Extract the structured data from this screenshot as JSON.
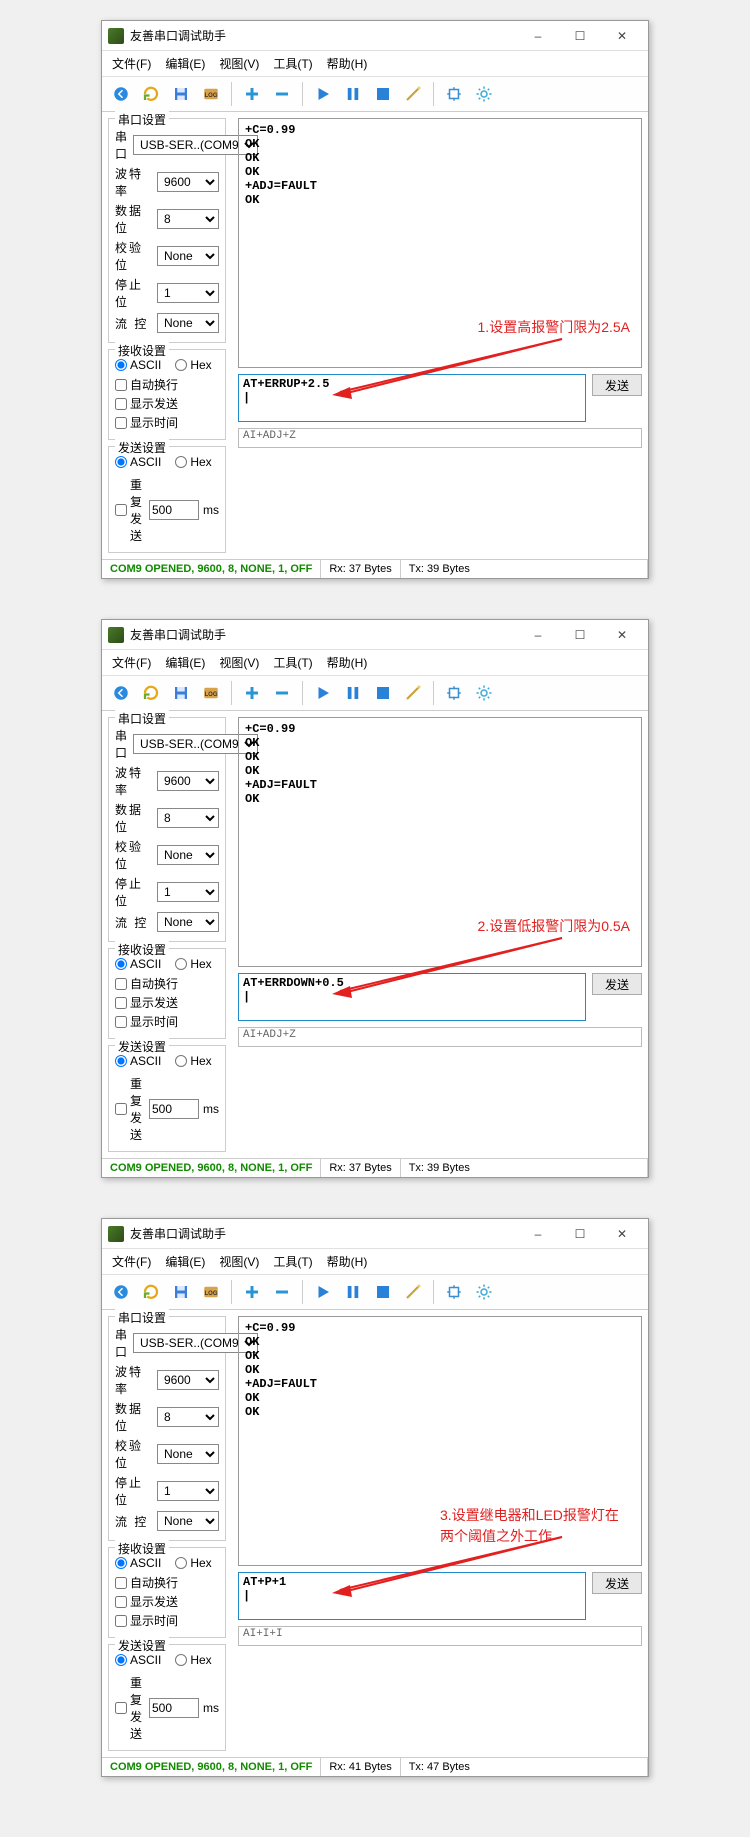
{
  "common": {
    "title": "友善串口调试助手",
    "menus": {
      "file": "文件(F)",
      "edit": "编辑(E)",
      "view": "视图(V)",
      "tools": "工具(T)",
      "help": "帮助(H)"
    },
    "toolbar_icons": [
      "back-icon",
      "reload-icon",
      "save-icon",
      "log-icon",
      "plus-icon",
      "minus-icon",
      "play-icon",
      "pause-icon",
      "stop-icon",
      "wand-icon",
      "target-icon",
      "gear-icon"
    ],
    "group_serial": {
      "legend": "串口设置",
      "port_label": "串  口",
      "port_value": "USB-SER..(COM9",
      "baud_label": "波特率",
      "baud_value": "9600",
      "databits_label": "数据位",
      "databits_value": "8",
      "parity_label": "校验位",
      "parity_value": "None",
      "stopbits_label": "停止位",
      "stopbits_value": "1",
      "flow_label": "流  控",
      "flow_value": "None"
    },
    "group_rx": {
      "legend": "接收设置",
      "ascii": "ASCII",
      "hex": "Hex",
      "auto_wrap": "自动换行",
      "show_send": "显示发送",
      "show_time": "显示时间"
    },
    "group_tx": {
      "legend": "发送设置",
      "ascii": "ASCII",
      "hex": "Hex",
      "repeat": "重复发送",
      "interval": "500",
      "ms": "ms"
    },
    "send_button": "发送",
    "win_min": "–",
    "win_max": "☐",
    "win_close": "✕"
  },
  "windows": [
    {
      "rx_text": "+C=0.99\nOK\nOK\nOK\n+ADJ=FAULT\nOK",
      "tx_text": "AT+ERRUP+2.5\n|",
      "history": "AI+ADJ+Z",
      "status_conn": "COM9 OPENED, 9600, 8, NONE, 1, OFF",
      "status_rx": "Rx: 37 Bytes",
      "status_tx": "Tx: 39 Bytes",
      "annotation": "1.设置高报警门限为2.5A"
    },
    {
      "rx_text": "+C=0.99\nOK\nOK\nOK\n+ADJ=FAULT\nOK",
      "tx_text": "AT+ERRDOWN+0.5\n|",
      "history": "AI+ADJ+Z",
      "status_conn": "COM9 OPENED, 9600, 8, NONE, 1, OFF",
      "status_rx": "Rx: 37 Bytes",
      "status_tx": "Tx: 39 Bytes",
      "annotation": "2.设置低报警门限为0.5A"
    },
    {
      "rx_text": "+C=0.99\nOK\nOK\nOK\n+ADJ=FAULT\nOK\nOK",
      "tx_text": "AT+P+1\n|",
      "history": "AI+I+I",
      "status_conn": "COM9 OPENED, 9600, 8, NONE, 1, OFF",
      "status_rx": "Rx: 41 Bytes",
      "status_tx": "Tx: 47 Bytes",
      "annotation": "3.设置继电器和LED报警灯在两个阈值之外工作"
    }
  ]
}
